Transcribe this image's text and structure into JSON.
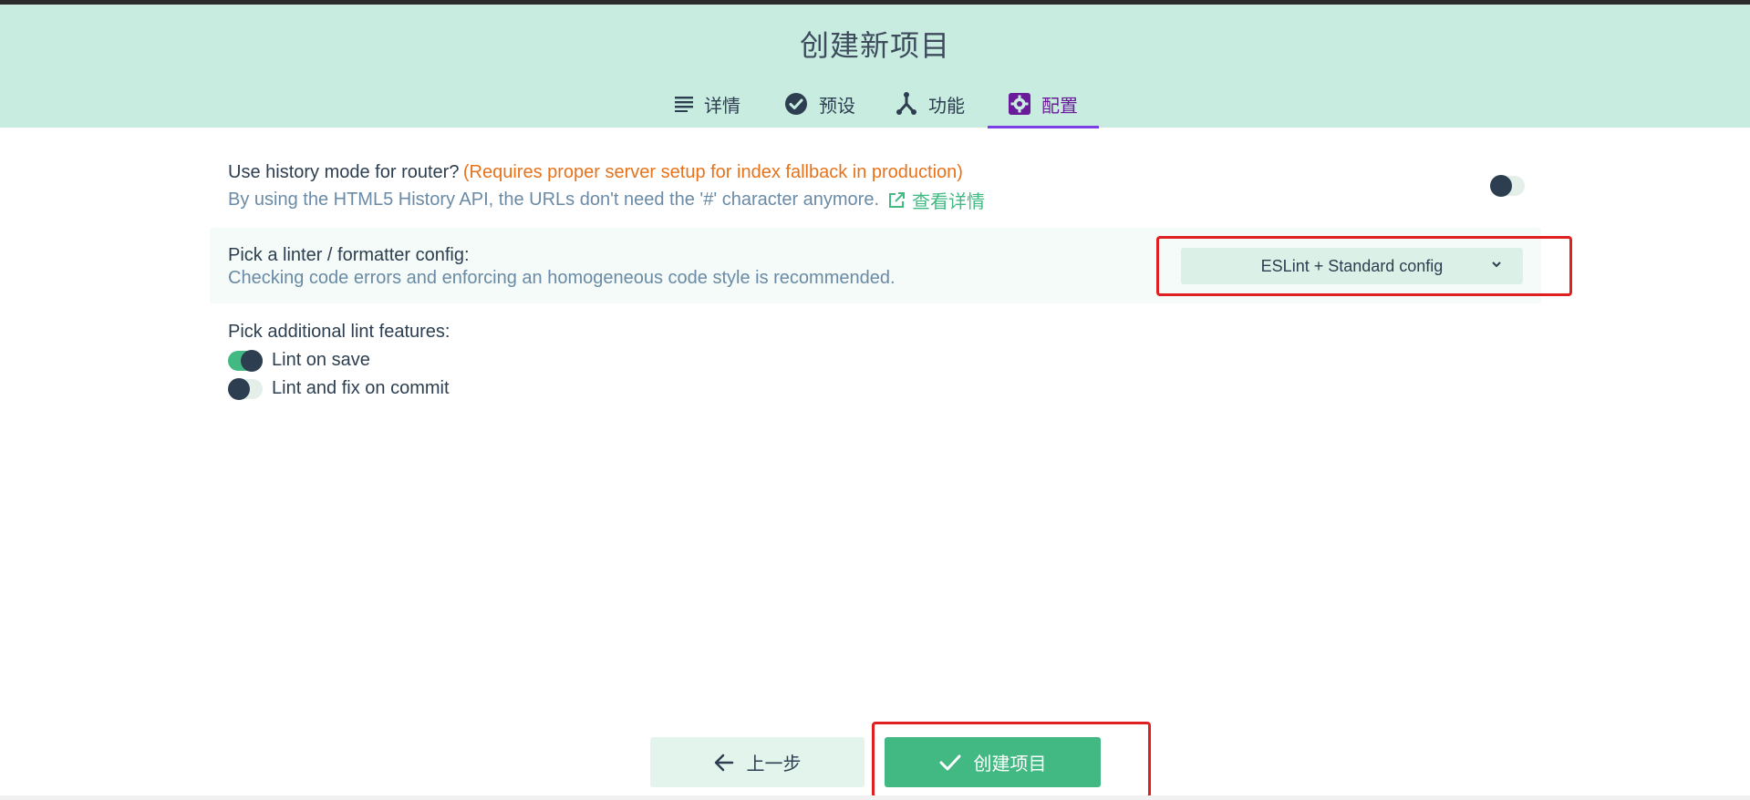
{
  "header": {
    "title": "创建新项目"
  },
  "tabs": [
    {
      "label": "详情",
      "icon": "list-icon"
    },
    {
      "label": "预设",
      "icon": "check-circle-icon"
    },
    {
      "label": "功能",
      "icon": "fork-icon"
    },
    {
      "label": "配置",
      "icon": "gear-icon",
      "active": true
    }
  ],
  "router": {
    "question": "Use history mode for router?",
    "warning": "(Requires proper server setup for index fallback in production)",
    "description": "By using the HTML5 History API, the URLs don't need the '#' character anymore.",
    "link_label": "查看详情",
    "enabled": false
  },
  "linter": {
    "label": "Pick a linter / formatter config:",
    "description": "Checking code errors and enforcing an homogeneous code style is recommended.",
    "selected": "ESLint + Standard config"
  },
  "lint_features": {
    "label": "Pick additional lint features:",
    "items": [
      {
        "label": "Lint on save",
        "enabled": true
      },
      {
        "label": "Lint and fix on commit",
        "enabled": false
      }
    ]
  },
  "footer": {
    "prev_label": "上一步",
    "create_label": "创建项目"
  },
  "colors": {
    "header_bg": "#c8ece0",
    "accent_green": "#42b983",
    "active_tab": "#6a1b9a",
    "warning_orange": "#e6731c",
    "annotation_red": "#e02020"
  }
}
